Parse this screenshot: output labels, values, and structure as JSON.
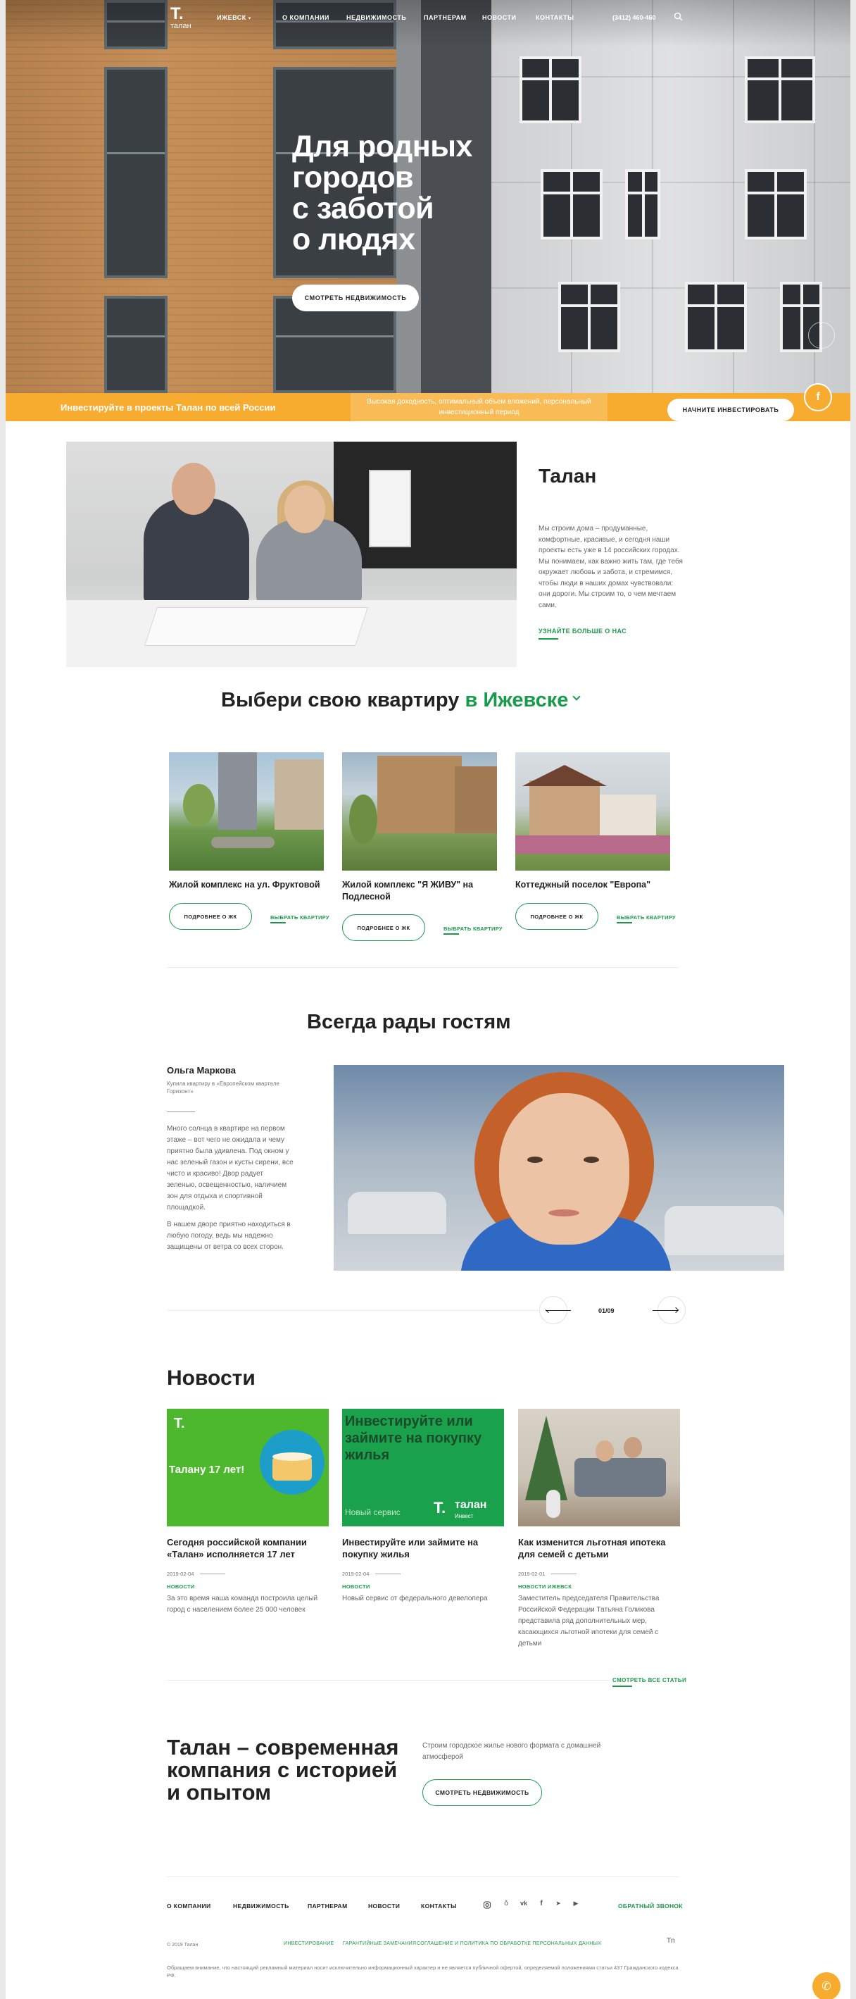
{
  "header": {
    "logo_mark": "Т.",
    "logo_text": "талан",
    "city": "Ижевск",
    "nav": [
      "О компании",
      "Недвижимость",
      "Партнерам",
      "Новости",
      "Контакты"
    ],
    "phone": "(3412) 460-460",
    "icons": {
      "search": "search-icon",
      "city_chevron": "chevron-down-icon"
    }
  },
  "hero": {
    "title_lines": [
      "Для родных",
      "городов",
      "с заботой",
      "о людях"
    ],
    "button": "Смотреть недвижимость"
  },
  "invest": {
    "headline": "Инвестируйте в проекты Талан по всей России",
    "details": "Высокая доходность, оптимальный объем вложений, персональный инвестиционный период",
    "button": "Начните инвестировать"
  },
  "about": {
    "title": "Талан",
    "text": "Мы строим дома – продуманные, комфортные, красивые, и сегодня наши проекты есть уже в 14 российских городах. Мы понимаем, как важно жить там, где тебя окружает любовь и забота, и стремимся, чтобы люди в наших домах чувствовали: они дороги. Мы строим то, о чем мечтаем сами.",
    "link": "Узнайте больше о нас"
  },
  "apartments": {
    "title_prefix": "Выбери свою квартиру",
    "city": "в Ижевске",
    "cards": [
      {
        "title": "Жилой комплекс на ул. Фруктовой",
        "more": "Подробнее о ЖК",
        "choose": "Выбрать квартиру"
      },
      {
        "title": "Жилой комплекс \"Я ЖИВУ\" на Подлесной",
        "more": "Подробнее о ЖК",
        "choose": "Выбрать квартиру"
      },
      {
        "title": "Коттеджный поселок \"Европа\"",
        "more": "Подробнее о ЖК",
        "choose": "Выбрать квартиру"
      }
    ]
  },
  "guests": {
    "title": "Всегда рады гостям",
    "name": "Ольга Маркова",
    "subtitle": "Купила квартиру в «Европейском квартале Горизонт»",
    "paragraph1": "Много солнца в квартире на первом этаже – вот чего не ожидала и чему приятно была удивлена. Под окном у нас зеленый газон и кусты сирени, все чисто и красиво! Двор радует зеленью, освещенностью, наличием зон для отдыха и спортивной площадкой.",
    "paragraph2": "В нашем дворе приятно находиться в любую погоду, ведь мы надежно защищены от ветра со всех сторон.",
    "counter": "01/09"
  },
  "news": {
    "title": "Новости",
    "items": [
      {
        "title": "Сегодня российской компании «Талан» исполняется 17 лет",
        "date": "2019-02-04",
        "tags": "Новости",
        "text": "За это время наша команда построила целый город с населением более 25 000 человек",
        "img_text": "Талану 17 лет!"
      },
      {
        "title": "Инвестируйте или займите на покупку жилья",
        "date": "2019-02-04",
        "tags": "Новости",
        "text": "Новый сервис от федерального девелопера",
        "img_text": "Инвестируйте или займите на покупку жилья",
        "img_sub": "Новый сервис",
        "img_logo": "талан",
        "img_logo_sub": "Инвест"
      },
      {
        "title": "Как изменится льготная ипотека для семей с детьми",
        "date": "2019-02-01",
        "tags": "Новости  Ижевск",
        "text": "Заместитель председателя Правительства Российской Федерации Татьяна Голикова представила ряд дополнительных мер, касающихся льготной ипотеки для семей с детьми"
      }
    ],
    "all_link": "Смотреть все статьи"
  },
  "cta": {
    "title": "Талан – современная компания с историей и опытом",
    "text": "Строим городское жилье нового формата с домашней атмосферой",
    "button": "Смотреть недвижимость"
  },
  "footer": {
    "nav": [
      "О компании",
      "Недвижимость",
      "Партнерам",
      "Новости",
      "Контакты"
    ],
    "social_icons": [
      "instagram-icon",
      "odnoklassniki-icon",
      "vk-icon",
      "facebook-icon",
      "telegram-icon",
      "youtube-icon"
    ],
    "callback": "Обратный звонок",
    "copyright": "© 2019 Талан",
    "links": [
      "Инвестирование",
      "Гарантийные замечания",
      "Соглашение и политика по обработке персональных данных"
    ],
    "developer_mark": "Tn",
    "disclaimer": "Обращаем внимание, что настоящий рекламный материал носит исключительно информационный характер и не является публичной офертой, определяемой положениями статьи 437 Гражданского кодекса РФ."
  },
  "colors": {
    "accent": "#1a9b4b",
    "orange": "#f7ac2f"
  }
}
